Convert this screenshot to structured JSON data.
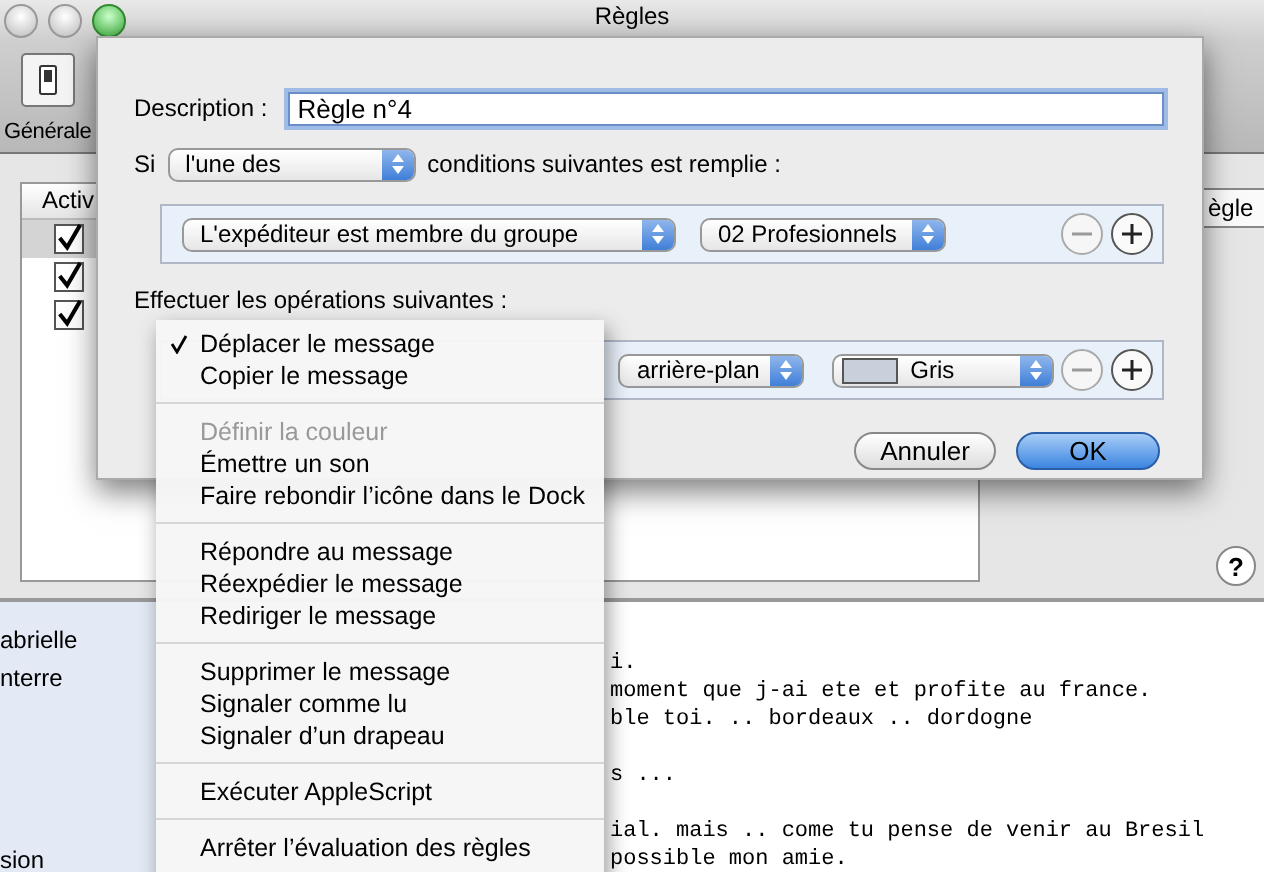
{
  "window": {
    "title": "Règles"
  },
  "toolbar": {
    "label": "Générale"
  },
  "rules_table": {
    "header": "Activ",
    "rows": [
      {
        "checked": true,
        "selected": true
      },
      {
        "checked": true,
        "selected": false
      },
      {
        "checked": true,
        "selected": false
      }
    ]
  },
  "side_button": "ègle",
  "help_button": "?",
  "mailboxes": [
    "abrielle",
    "nterre",
    "sion"
  ],
  "message_paragraphs": [
    [
      "i.",
      "moment que j-ai ete et profite au france.",
      "ble toi. .. bordeaux .. dordogne"
    ],
    [
      "s ..."
    ],
    [
      "ial. mais .. come tu pense de venir au Bresil",
      "possible mon amie."
    ]
  ],
  "sheet": {
    "description_label": "Description :",
    "description_value": "Règle n°4",
    "si_label": "Si",
    "match_popup": "l'une des",
    "conditions_label": "conditions suivantes est remplie :",
    "condition": {
      "field": "L'expéditeur est membre du groupe",
      "value": "02 Profesionnels"
    },
    "actions_label": "Effectuer les opérations suivantes :",
    "action": {
      "option": "arrière-plan",
      "color_label": "Gris"
    },
    "buttons": [
      {
        "label": "Annuler",
        "kind": "secondary"
      },
      {
        "label": "OK",
        "kind": "default"
      }
    ]
  },
  "menu": {
    "items": [
      {
        "kind": "item",
        "label": "Déplacer le message",
        "checked": true,
        "disabled": false
      },
      {
        "kind": "item",
        "label": "Copier le message",
        "checked": false,
        "disabled": false
      },
      {
        "kind": "separator"
      },
      {
        "kind": "item",
        "label": "Définir la couleur",
        "checked": false,
        "disabled": true
      },
      {
        "kind": "item",
        "label": "Émettre un son",
        "checked": false,
        "disabled": false
      },
      {
        "kind": "item",
        "label": "Faire rebondir l’icône dans le Dock",
        "checked": false,
        "disabled": false
      },
      {
        "kind": "separator"
      },
      {
        "kind": "item",
        "label": "Répondre au message",
        "checked": false,
        "disabled": false
      },
      {
        "kind": "item",
        "label": "Réexpédier le message",
        "checked": false,
        "disabled": false
      },
      {
        "kind": "item",
        "label": "Rediriger le message",
        "checked": false,
        "disabled": false
      },
      {
        "kind": "separator"
      },
      {
        "kind": "item",
        "label": "Supprimer le message",
        "checked": false,
        "disabled": false
      },
      {
        "kind": "item",
        "label": "Signaler comme lu",
        "checked": false,
        "disabled": false
      },
      {
        "kind": "item",
        "label": "Signaler d’un drapeau",
        "checked": false,
        "disabled": false
      },
      {
        "kind": "separator"
      },
      {
        "kind": "item",
        "label": "Exécuter AppleScript",
        "checked": false,
        "disabled": false
      },
      {
        "kind": "separator"
      },
      {
        "kind": "item",
        "label": "Arrêter l’évaluation des règles",
        "checked": false,
        "disabled": false
      }
    ]
  }
}
